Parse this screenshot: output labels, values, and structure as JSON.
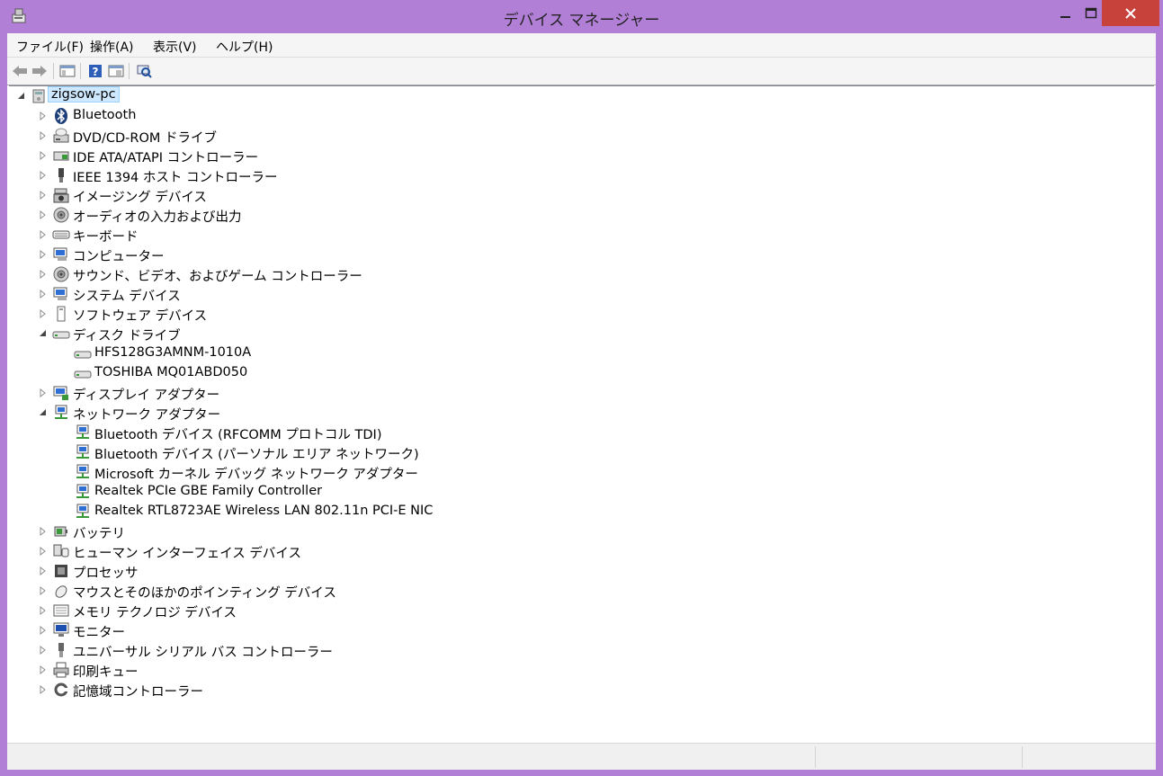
{
  "window": {
    "title": "デバイス マネージャー"
  },
  "menu": [
    "ファイル(F)",
    "操作(A)",
    "表示(V)",
    "ヘルプ(H)"
  ],
  "toolbar": [
    "back-arrow-icon",
    "forward-arrow-icon",
    "show-hide-console-tree-icon",
    "help-icon",
    "properties-icon",
    "scan-hardware-icon"
  ],
  "tree": {
    "root": "zigsow-pc",
    "items": [
      {
        "label": "Bluetooth",
        "icon": "bluetooth-icon",
        "expanded": false,
        "children": []
      },
      {
        "label": "DVD/CD-ROM ドライブ",
        "icon": "dvd-drive-icon",
        "expanded": false,
        "children": []
      },
      {
        "label": "IDE ATA/ATAPI コントローラー",
        "icon": "ide-controller-icon",
        "expanded": false,
        "children": []
      },
      {
        "label": "IEEE 1394 ホスト コントローラー",
        "icon": "ieee1394-icon",
        "expanded": false,
        "children": []
      },
      {
        "label": "イメージング デバイス",
        "icon": "camera-icon",
        "expanded": false,
        "children": []
      },
      {
        "label": "オーディオの入力および出力",
        "icon": "speaker-icon",
        "expanded": false,
        "children": []
      },
      {
        "label": "キーボード",
        "icon": "keyboard-icon",
        "expanded": false,
        "children": []
      },
      {
        "label": "コンピューター",
        "icon": "computer-icon",
        "expanded": false,
        "children": []
      },
      {
        "label": "サウンド、ビデオ、およびゲーム コントローラー",
        "icon": "speaker-icon",
        "expanded": false,
        "children": []
      },
      {
        "label": "システム デバイス",
        "icon": "computer-icon",
        "expanded": false,
        "children": []
      },
      {
        "label": "ソフトウェア デバイス",
        "icon": "software-device-icon",
        "expanded": false,
        "children": []
      },
      {
        "label": "ディスク ドライブ",
        "icon": "disk-drive-icon",
        "expanded": true,
        "children": [
          "HFS128G3AMNM-1010A",
          "TOSHIBA MQ01ABD050"
        ]
      },
      {
        "label": "ディスプレイ アダプター",
        "icon": "display-adapter-icon",
        "expanded": false,
        "children": []
      },
      {
        "label": "ネットワーク アダプター",
        "icon": "network-icon",
        "expanded": true,
        "children": [
          "Bluetooth デバイス (RFCOMM プロトコル TDI)",
          "Bluetooth デバイス (パーソナル エリア ネットワーク)",
          "Microsoft カーネル デバッグ ネットワーク アダプター",
          "Realtek PCIe GBE Family Controller",
          "Realtek RTL8723AE Wireless LAN 802.11n PCI-E NIC"
        ]
      },
      {
        "label": "バッテリ",
        "icon": "battery-icon",
        "expanded": false,
        "children": []
      },
      {
        "label": "ヒューマン インターフェイス デバイス",
        "icon": "hid-icon",
        "expanded": false,
        "children": []
      },
      {
        "label": "プロセッサ",
        "icon": "processor-icon",
        "expanded": false,
        "children": []
      },
      {
        "label": "マウスとそのほかのポインティング デバイス",
        "icon": "mouse-icon",
        "expanded": false,
        "children": []
      },
      {
        "label": "メモリ テクノロジ デバイス",
        "icon": "memory-icon",
        "expanded": false,
        "children": []
      },
      {
        "label": "モニター",
        "icon": "monitor-icon",
        "expanded": false,
        "children": []
      },
      {
        "label": "ユニバーサル シリアル バス コントローラー",
        "icon": "usb-icon",
        "expanded": false,
        "children": []
      },
      {
        "label": "印刷キュー",
        "icon": "printer-icon",
        "expanded": false,
        "children": []
      },
      {
        "label": "記憶域コントローラー",
        "icon": "storage-controller-icon",
        "expanded": false,
        "children": []
      }
    ]
  },
  "colors": {
    "frame": "#b27fd7",
    "close": "#c7423a",
    "selection": "#cde8ff"
  }
}
